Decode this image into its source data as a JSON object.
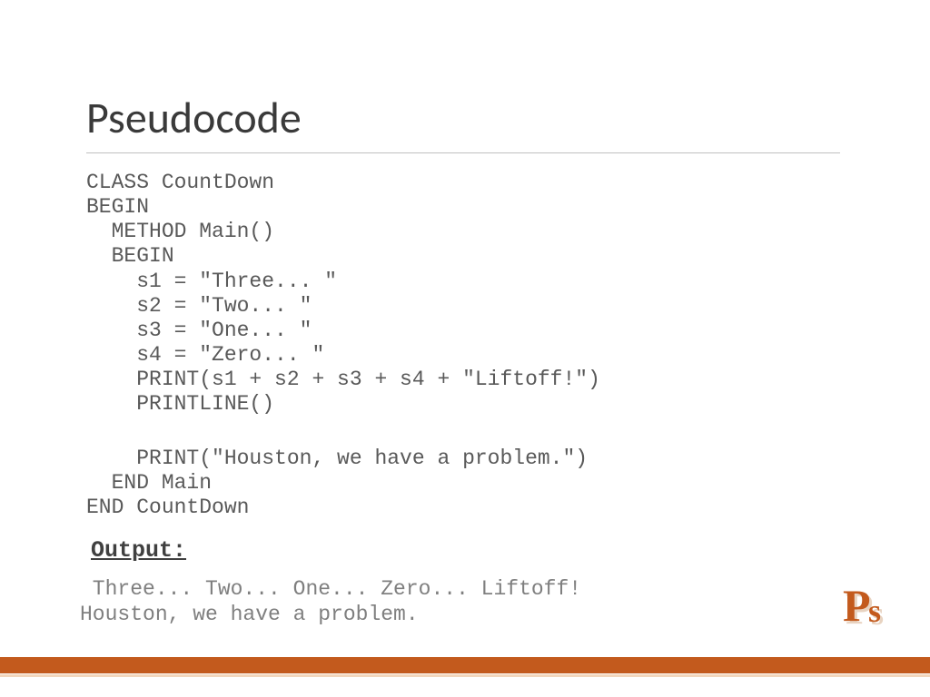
{
  "title": "Pseudocode",
  "code_block1": "CLASS CountDown\nBEGIN\n  METHOD Main()\n  BEGIN\n    s1 = \"Three... \"\n    s2 = \"Two... \"\n    s3 = \"One... \"\n    s4 = \"Zero... \"\n    PRINT(s1 + s2 + s3 + s4 + \"Liftoff!\")\n    PRINTLINE()",
  "code_block2": "    PRINT(\"Houston, we have a problem.\")\n  END Main\nEND CountDown",
  "output_label": "Output:",
  "output_text": " Three... Two... One... Zero... Liftoff!\nHouston, we have a problem.",
  "logo": {
    "p": "P",
    "s": "s"
  }
}
